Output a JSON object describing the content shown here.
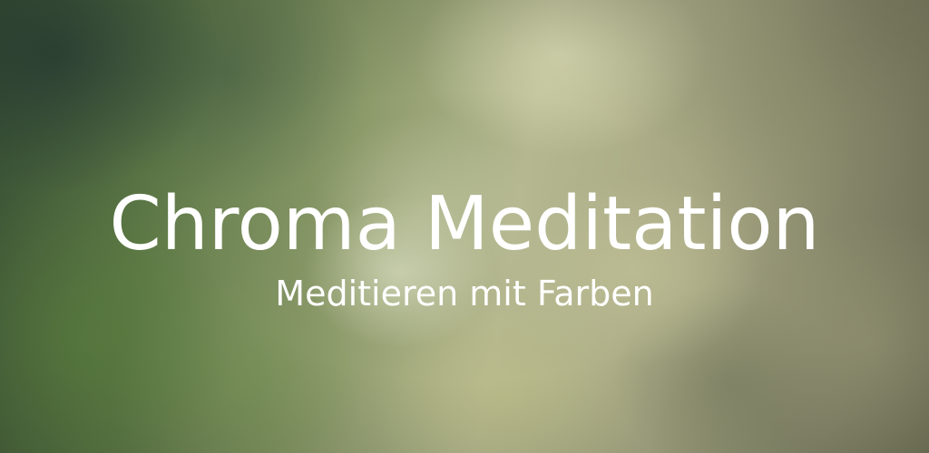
{
  "banner": {
    "title": "Chroma Meditation",
    "subtitle": "Meditieren mit Farben",
    "text_color": "#ffffff"
  }
}
